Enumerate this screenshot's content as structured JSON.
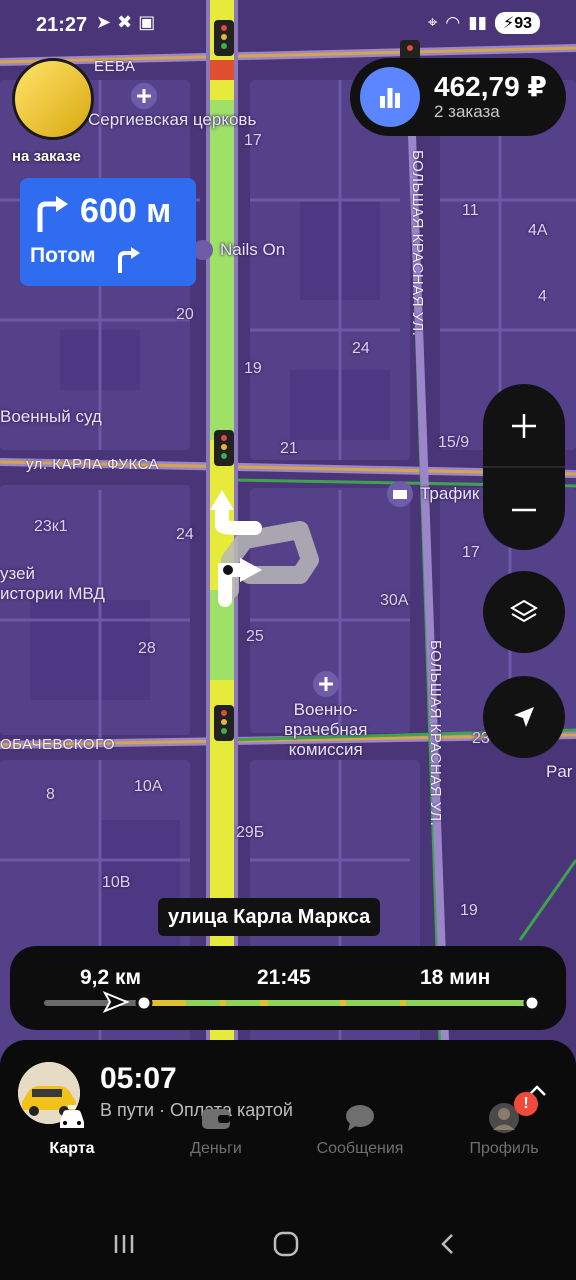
{
  "status_bar": {
    "time": "21:27",
    "battery": "93"
  },
  "driver": {
    "status": "на заказе"
  },
  "earnings": {
    "amount": "462,79 ₽",
    "orders": "2 заказа"
  },
  "maneuver": {
    "distance": "600 м",
    "next_label": "Потом"
  },
  "map": {
    "labels": {
      "church": "Сергиевская церковь",
      "nails": "Nails On",
      "court": "Военный суд",
      "trafik": "Трафик",
      "museum": "узей\nистории МВД",
      "commission": "Военно-\nврачебная\nкомиссия",
      "para": "Par"
    },
    "house_numbers": {
      "n17a": "17",
      "n11": "11",
      "n4a": "4А",
      "n4": "4",
      "n20": "20",
      "n24a": "24",
      "n19": "19",
      "n21": "21",
      "n15_9": "15/9",
      "n23k1": "23к1",
      "n24b": "24",
      "n17b": "17",
      "n30a": "30А",
      "n28": "28",
      "n25": "25",
      "n23": "23",
      "n10a": "10А",
      "n8": "8",
      "n29b": "29Б",
      "n10v": "10В",
      "n19b": "19"
    },
    "streets": {
      "karla_fuksa": "ул. КАРЛА ФУКСА",
      "lobachevskogo": "ОБАЧЕВСКОГО",
      "eeva": "ЕЕВА",
      "bk_top": "БОЛЬШАЯ КРАСНАЯ УЛ.",
      "bk_bottom": "БОЛЬШАЯ КРАСНАЯ УЛ."
    }
  },
  "current_street": "улица Карла Маркса",
  "route_info": {
    "distance": "9,2 км",
    "arrival": "21:45",
    "duration": "18 мин"
  },
  "order": {
    "time": "05:07",
    "status": "В пути · Оплата картой"
  },
  "tabs": [
    {
      "label": "Карта",
      "icon": "taxi-car-icon",
      "active": true
    },
    {
      "label": "Деньги",
      "icon": "wallet-icon",
      "active": false
    },
    {
      "label": "Сообщения",
      "icon": "chat-bubble-icon",
      "active": false
    },
    {
      "label": "Профиль",
      "icon": "profile-avatar-icon",
      "active": false
    }
  ],
  "colors": {
    "map_bg": "#4a3578",
    "route": "#e0e63a",
    "route_green": "#8bd35a",
    "accent_blue": "#2f6cf0",
    "earn_blue": "#5b86ff"
  }
}
